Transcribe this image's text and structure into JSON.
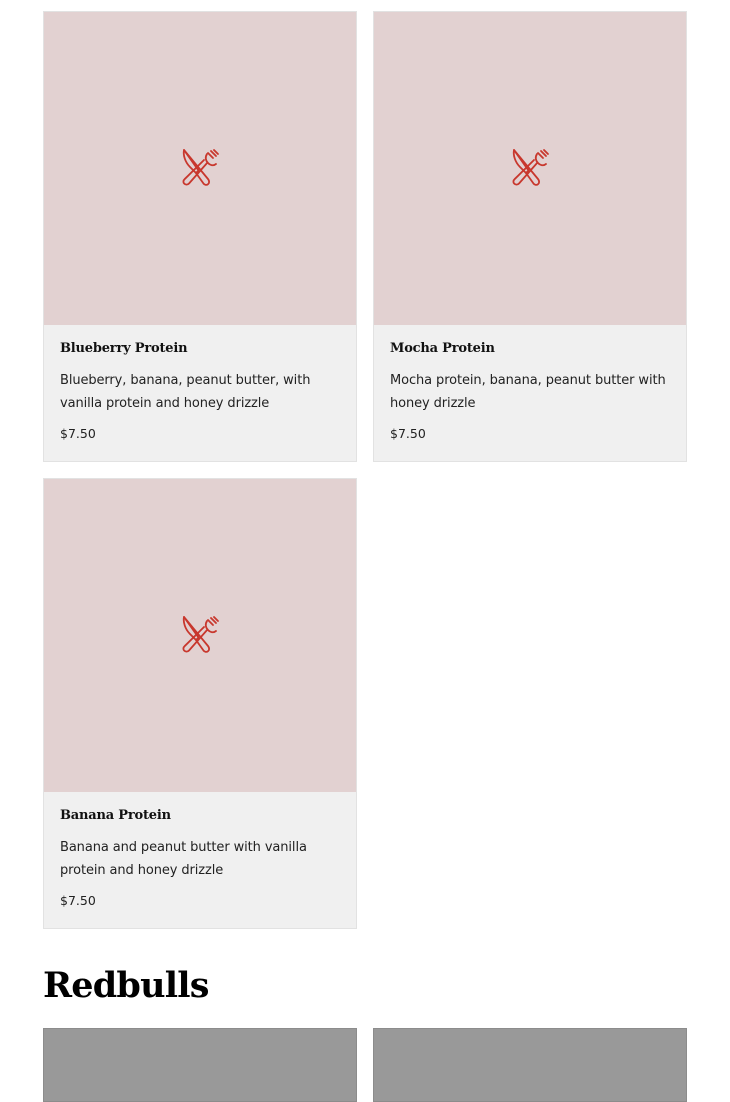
{
  "colors": {
    "card_background": "#f0f0f0",
    "image_placeholder": "#e2d1d1",
    "icon": "#c8372d",
    "next_section_placeholder": "#999999"
  },
  "menu_items": [
    {
      "name": "Blueberry Protein",
      "description": "Blueberry, banana, peanut butter, with vanilla protein and honey drizzle",
      "price": "$7.50",
      "icon": "fork-knife-icon"
    },
    {
      "name": "Mocha Protein",
      "description": "Mocha protein, banana, peanut butter with honey drizzle",
      "price": "$7.50",
      "icon": "fork-knife-icon"
    },
    {
      "name": "Banana Protein",
      "description": "Banana and peanut butter with vanilla protein and honey drizzle",
      "price": "$7.50",
      "icon": "fork-knife-icon"
    }
  ],
  "sections": [
    {
      "title": "Redbulls"
    }
  ]
}
